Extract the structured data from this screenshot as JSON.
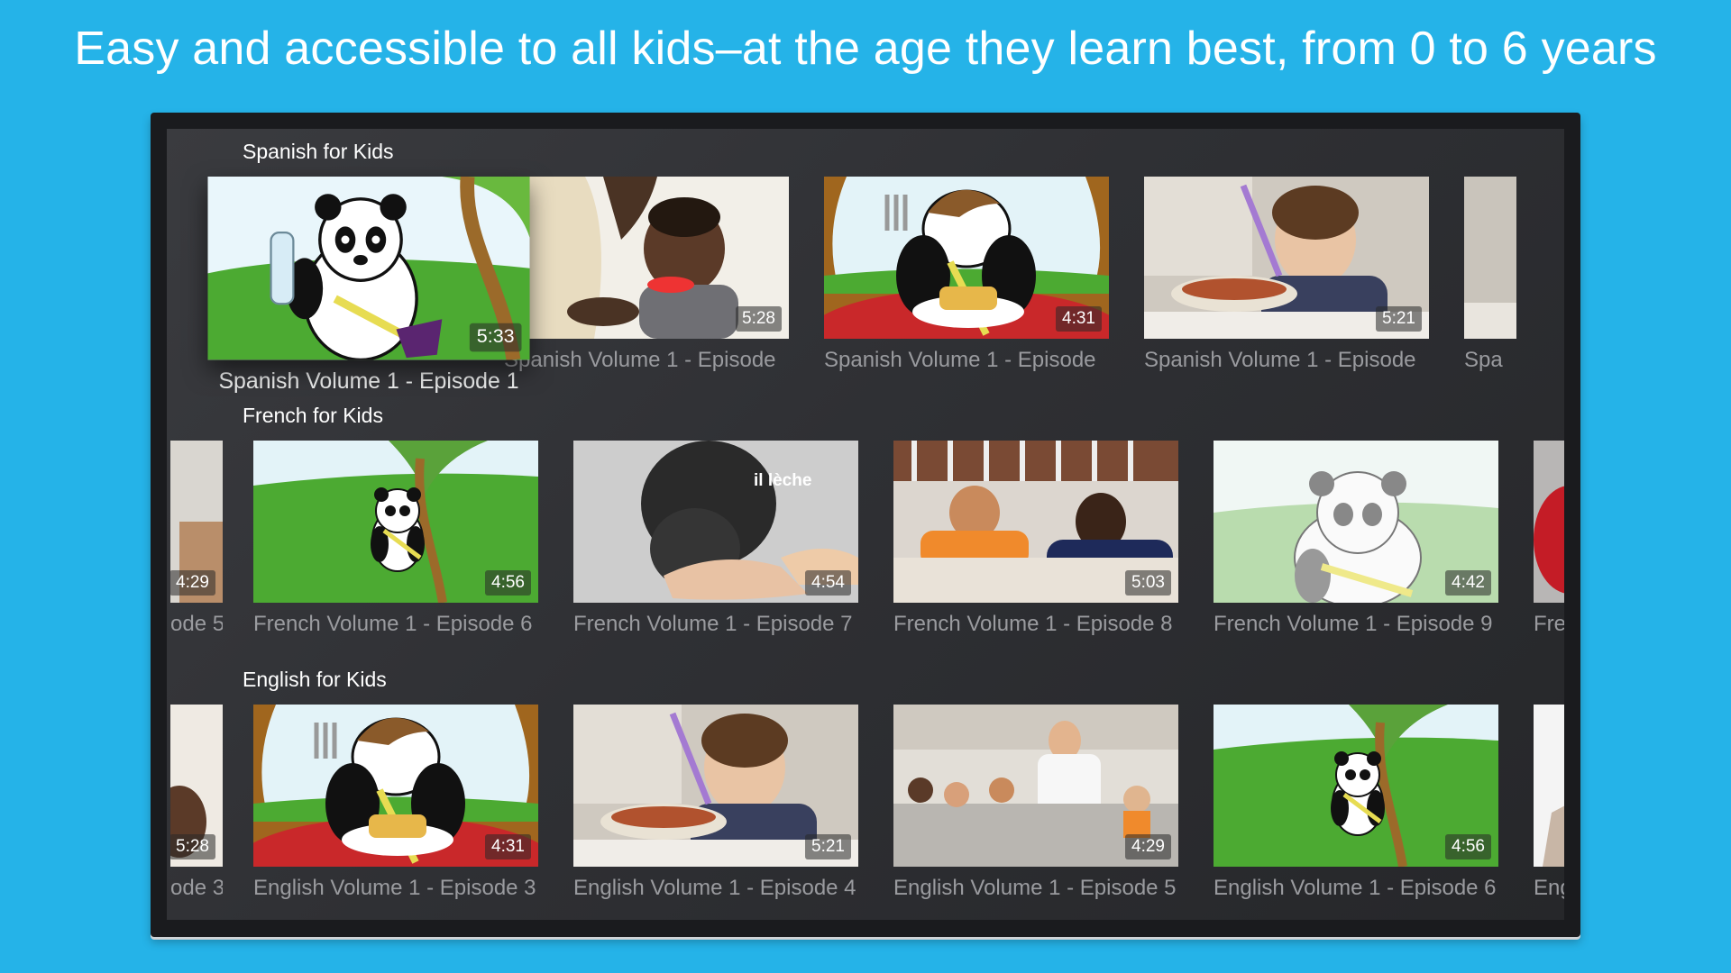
{
  "headline": "Easy and accessible to all kids–at the age they learn best, from 0 to 6 years",
  "rows": [
    {
      "title": "Spanish for Kids",
      "cards": [
        {
          "title": "Spanish Volume 1 - Episode 1",
          "duration": "5:33",
          "thumb": "panda-bottle"
        },
        {
          "title": "Spanish Volume 1 - Episode",
          "duration": "5:28",
          "thumb": "baby-eating"
        },
        {
          "title": "Spanish Volume 1 - Episode",
          "duration": "4:31",
          "thumb": "panda-pancakes"
        },
        {
          "title": "Spanish Volume 1 - Episode",
          "duration": "5:21",
          "thumb": "toddler-bowl"
        },
        {
          "title": "Spa",
          "duration": "",
          "thumb": "kitchen"
        }
      ]
    },
    {
      "title": "French for Kids",
      "cards": [
        {
          "title": "ode 5",
          "duration": "4:29",
          "thumb": "kitchen"
        },
        {
          "title": "French Volume 1 - Episode 6",
          "duration": "4:56",
          "thumb": "panda-tree"
        },
        {
          "title": "French Volume 1 - Episode 7",
          "duration": "4:54",
          "thumb": "kitten",
          "caption": "il lèche"
        },
        {
          "title": "French Volume 1 - Episode 8",
          "duration": "5:03",
          "thumb": "kids-bed"
        },
        {
          "title": "French Volume 1 - Episode 9",
          "duration": "4:42",
          "thumb": "panda-faded"
        },
        {
          "title": "Fre",
          "duration": "",
          "thumb": "red"
        }
      ]
    },
    {
      "title": "English for Kids",
      "cards": [
        {
          "title": "ode 3",
          "duration": "5:28",
          "thumb": "baby-eating"
        },
        {
          "title": "English Volume 1 - Episode 3",
          "duration": "4:31",
          "thumb": "panda-pancakes"
        },
        {
          "title": "English Volume 1 - Episode 4",
          "duration": "5:21",
          "thumb": "toddler-bowl"
        },
        {
          "title": "English Volume 1 - Episode 5",
          "duration": "4:29",
          "thumb": "kitchen"
        },
        {
          "title": "English Volume 1 - Episode 6",
          "duration": "4:56",
          "thumb": "panda-tree"
        },
        {
          "title": "Eng",
          "duration": "",
          "thumb": "white"
        }
      ]
    }
  ],
  "colors": {
    "background": "#25b3e8",
    "tv_frame": "#1a1b1e",
    "grass": "#4caa32",
    "sky": "#dff2fa"
  }
}
